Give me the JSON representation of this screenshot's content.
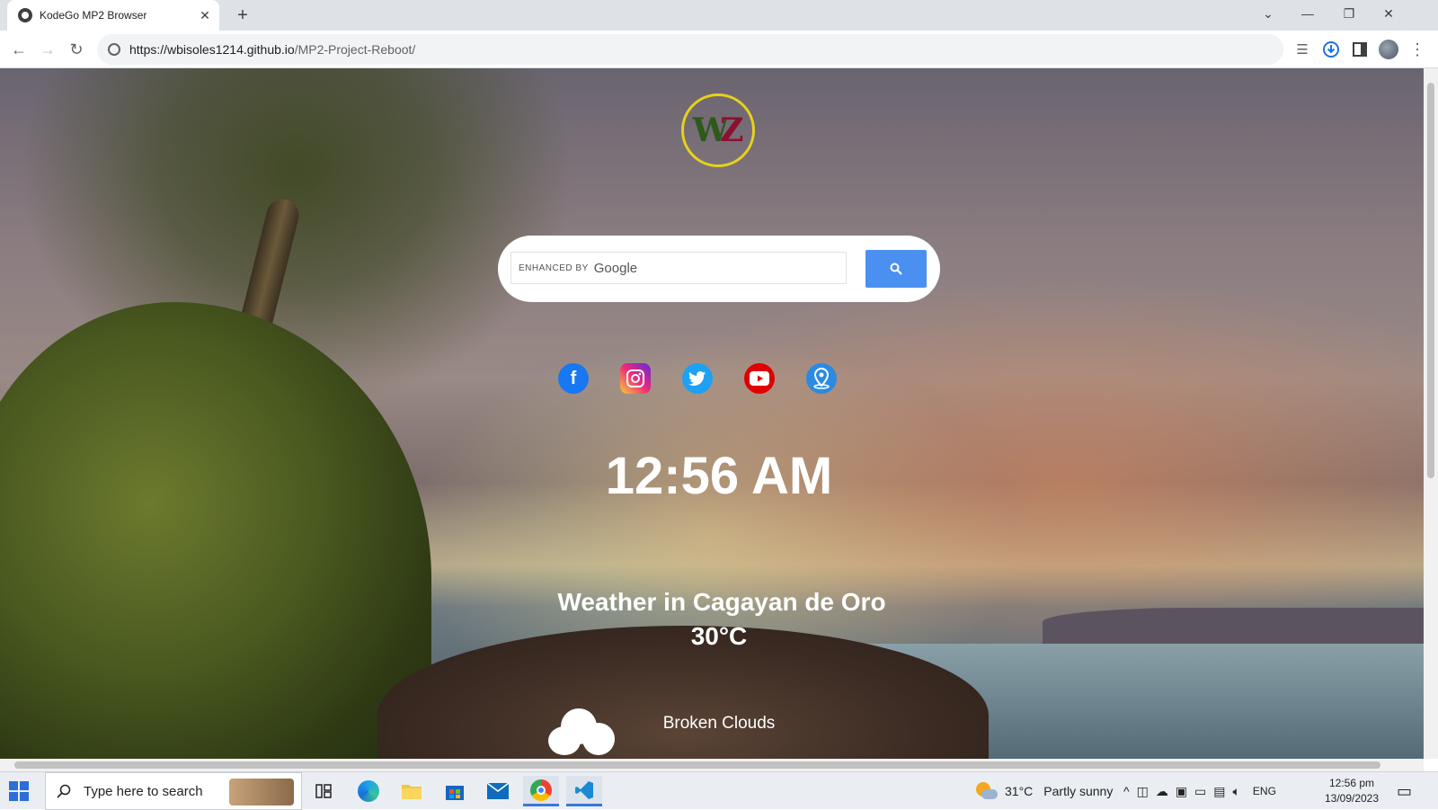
{
  "browser": {
    "tab_title": "KodeGo MP2 Browser",
    "url_host": "https://wbisoles1214.github.io",
    "url_path": "/MP2-Project-Reboot/"
  },
  "search": {
    "enhanced_by": "ENHANCED BY",
    "google": "Google"
  },
  "social_links": [
    {
      "name": "facebook",
      "color": "#1877f2"
    },
    {
      "name": "instagram",
      "color": "#d6249f"
    },
    {
      "name": "twitter",
      "color": "#1da1f2"
    },
    {
      "name": "youtube",
      "color": "#e00000"
    },
    {
      "name": "location",
      "color": "#2b8ae2"
    }
  ],
  "clock": {
    "time": "12:56 AM"
  },
  "weather": {
    "title": "Weather in Cagayan de Oro",
    "temperature": "30°C",
    "description": "Broken Clouds"
  },
  "taskbar": {
    "search_placeholder": "Type here to search",
    "weather_temp": "31°C",
    "weather_desc": "Partly sunny",
    "language": "ENG",
    "time": "12:56 pm",
    "date": "13/09/2023"
  }
}
